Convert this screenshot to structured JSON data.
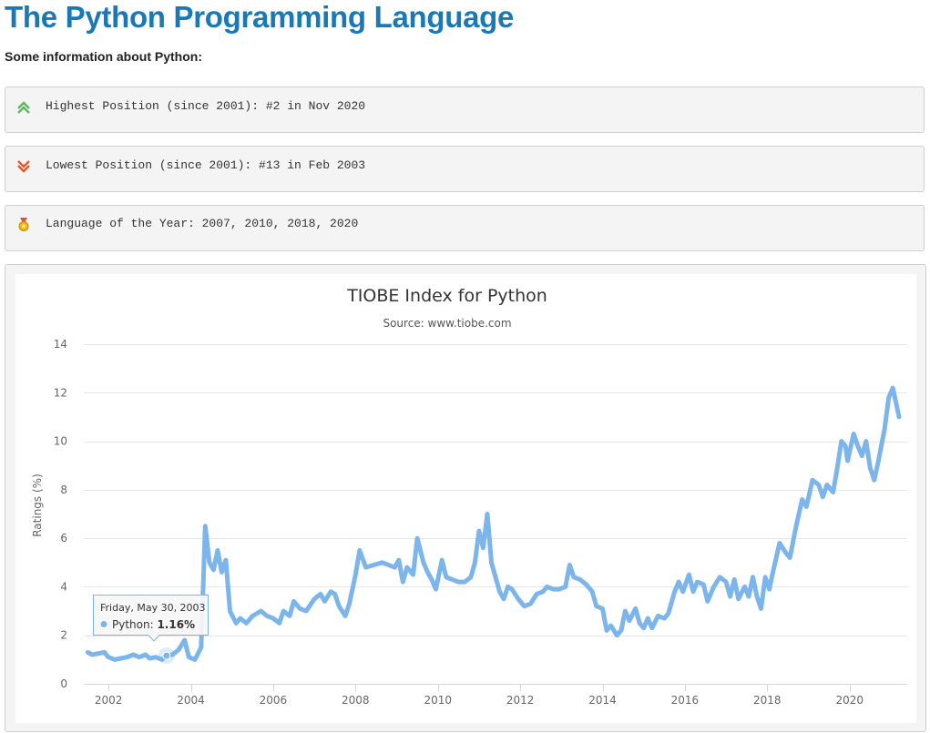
{
  "page": {
    "title": "The Python Programming Language",
    "subtitle": "Some information about Python:"
  },
  "info": {
    "highest": {
      "text": "Highest Position (since 2001): #2 in Nov 2020",
      "icon": "double-chevron-up-icon",
      "color": "#5cb85c"
    },
    "lowest": {
      "text": "Lowest Position (since 2001): #13 in Feb 2003",
      "icon": "double-chevron-down-icon",
      "color": "#e05a2b"
    },
    "year": {
      "text": "Language of the Year: 2007, 2010, 2018, 2020",
      "icon": "medal-icon",
      "color": "#f0b400"
    }
  },
  "tooltip": {
    "date": "Friday, May 30, 2003",
    "series_label": "Python: ",
    "value_label": "1.16%"
  },
  "chart_data": {
    "type": "line",
    "title": "TIOBE Index for Python",
    "subtitle": "Source: www.tiobe.com",
    "xlabel": "",
    "ylabel": "Ratings (%)",
    "ylim": [
      0,
      14
    ],
    "xlim": [
      2001.4,
      2021.4
    ],
    "yticks": [
      0,
      2,
      4,
      6,
      8,
      10,
      12,
      14
    ],
    "xticks": [
      2002,
      2004,
      2006,
      2008,
      2010,
      2012,
      2014,
      2016,
      2018,
      2020
    ],
    "grid": true,
    "line_color": "#7cb5ec",
    "highlight": {
      "x": 2003.41,
      "y": 1.16
    },
    "series": [
      {
        "name": "Python",
        "points": [
          [
            2001.5,
            1.3
          ],
          [
            2001.6,
            1.2
          ],
          [
            2001.75,
            1.25
          ],
          [
            2001.9,
            1.3
          ],
          [
            2002.0,
            1.1
          ],
          [
            2002.15,
            1.0
          ],
          [
            2002.3,
            1.05
          ],
          [
            2002.45,
            1.1
          ],
          [
            2002.6,
            1.2
          ],
          [
            2002.75,
            1.1
          ],
          [
            2002.9,
            1.2
          ],
          [
            2003.0,
            1.05
          ],
          [
            2003.15,
            1.1
          ],
          [
            2003.3,
            1.0
          ],
          [
            2003.41,
            1.16
          ],
          [
            2003.55,
            1.2
          ],
          [
            2003.7,
            1.4
          ],
          [
            2003.85,
            1.8
          ],
          [
            2003.95,
            1.1
          ],
          [
            2004.1,
            1.0
          ],
          [
            2004.25,
            1.5
          ],
          [
            2004.35,
            6.5
          ],
          [
            2004.45,
            5.0
          ],
          [
            2004.55,
            4.7
          ],
          [
            2004.65,
            5.5
          ],
          [
            2004.75,
            4.6
          ],
          [
            2004.85,
            5.1
          ],
          [
            2004.95,
            3.0
          ],
          [
            2005.1,
            2.5
          ],
          [
            2005.2,
            2.7
          ],
          [
            2005.35,
            2.5
          ],
          [
            2005.5,
            2.8
          ],
          [
            2005.7,
            3.0
          ],
          [
            2005.85,
            2.8
          ],
          [
            2006.0,
            2.7
          ],
          [
            2006.15,
            2.5
          ],
          [
            2006.25,
            3.0
          ],
          [
            2006.4,
            2.8
          ],
          [
            2006.5,
            3.4
          ],
          [
            2006.65,
            3.1
          ],
          [
            2006.8,
            3.0
          ],
          [
            2007.0,
            3.5
          ],
          [
            2007.15,
            3.7
          ],
          [
            2007.25,
            3.4
          ],
          [
            2007.4,
            3.8
          ],
          [
            2007.5,
            3.7
          ],
          [
            2007.6,
            3.2
          ],
          [
            2007.75,
            2.8
          ],
          [
            2007.85,
            3.3
          ],
          [
            2008.0,
            4.5
          ],
          [
            2008.1,
            5.5
          ],
          [
            2008.25,
            4.8
          ],
          [
            2008.45,
            4.9
          ],
          [
            2008.65,
            5.0
          ],
          [
            2008.8,
            4.9
          ],
          [
            2008.95,
            4.8
          ],
          [
            2009.05,
            5.1
          ],
          [
            2009.15,
            4.2
          ],
          [
            2009.25,
            4.8
          ],
          [
            2009.4,
            4.5
          ],
          [
            2009.5,
            6.0
          ],
          [
            2009.65,
            5.0
          ],
          [
            2009.75,
            4.6
          ],
          [
            2009.85,
            4.3
          ],
          [
            2009.95,
            3.9
          ],
          [
            2010.1,
            5.1
          ],
          [
            2010.2,
            4.4
          ],
          [
            2010.35,
            4.3
          ],
          [
            2010.5,
            4.2
          ],
          [
            2010.65,
            4.2
          ],
          [
            2010.8,
            4.4
          ],
          [
            2010.9,
            5.0
          ],
          [
            2011.0,
            6.3
          ],
          [
            2011.1,
            5.6
          ],
          [
            2011.2,
            7.0
          ],
          [
            2011.3,
            5.0
          ],
          [
            2011.4,
            4.4
          ],
          [
            2011.5,
            3.8
          ],
          [
            2011.6,
            3.5
          ],
          [
            2011.7,
            4.0
          ],
          [
            2011.8,
            3.9
          ],
          [
            2011.95,
            3.5
          ],
          [
            2012.1,
            3.2
          ],
          [
            2012.25,
            3.3
          ],
          [
            2012.4,
            3.7
          ],
          [
            2012.55,
            3.8
          ],
          [
            2012.65,
            4.0
          ],
          [
            2012.8,
            3.9
          ],
          [
            2012.95,
            3.9
          ],
          [
            2013.1,
            4.0
          ],
          [
            2013.2,
            4.9
          ],
          [
            2013.3,
            4.4
          ],
          [
            2013.45,
            4.3
          ],
          [
            2013.6,
            4.1
          ],
          [
            2013.75,
            3.8
          ],
          [
            2013.85,
            3.2
          ],
          [
            2014.0,
            3.1
          ],
          [
            2014.1,
            2.2
          ],
          [
            2014.2,
            2.4
          ],
          [
            2014.35,
            2.0
          ],
          [
            2014.45,
            2.2
          ],
          [
            2014.55,
            3.0
          ],
          [
            2014.65,
            2.6
          ],
          [
            2014.8,
            3.1
          ],
          [
            2014.9,
            2.5
          ],
          [
            2015.0,
            2.3
          ],
          [
            2015.1,
            2.7
          ],
          [
            2015.2,
            2.3
          ],
          [
            2015.35,
            2.8
          ],
          [
            2015.5,
            2.7
          ],
          [
            2015.6,
            2.9
          ],
          [
            2015.75,
            3.8
          ],
          [
            2015.85,
            4.2
          ],
          [
            2015.95,
            3.8
          ],
          [
            2016.1,
            4.5
          ],
          [
            2016.2,
            3.8
          ],
          [
            2016.3,
            4.2
          ],
          [
            2016.45,
            4.1
          ],
          [
            2016.55,
            3.4
          ],
          [
            2016.7,
            4.0
          ],
          [
            2016.85,
            4.4
          ],
          [
            2017.0,
            4.2
          ],
          [
            2017.1,
            3.6
          ],
          [
            2017.2,
            4.3
          ],
          [
            2017.3,
            3.5
          ],
          [
            2017.45,
            4.0
          ],
          [
            2017.55,
            3.6
          ],
          [
            2017.65,
            4.4
          ],
          [
            2017.75,
            3.6
          ],
          [
            2017.85,
            3.1
          ],
          [
            2017.95,
            4.4
          ],
          [
            2018.05,
            3.9
          ],
          [
            2018.15,
            4.7
          ],
          [
            2018.3,
            5.8
          ],
          [
            2018.45,
            5.4
          ],
          [
            2018.55,
            5.2
          ],
          [
            2018.7,
            6.5
          ],
          [
            2018.85,
            7.6
          ],
          [
            2018.95,
            7.3
          ],
          [
            2019.1,
            8.4
          ],
          [
            2019.25,
            8.2
          ],
          [
            2019.35,
            7.7
          ],
          [
            2019.45,
            8.2
          ],
          [
            2019.6,
            7.9
          ],
          [
            2019.7,
            8.9
          ],
          [
            2019.8,
            10.0
          ],
          [
            2019.9,
            9.8
          ],
          [
            2019.95,
            9.2
          ],
          [
            2020.1,
            10.3
          ],
          [
            2020.2,
            9.8
          ],
          [
            2020.3,
            9.4
          ],
          [
            2020.4,
            10.0
          ],
          [
            2020.5,
            8.9
          ],
          [
            2020.6,
            8.4
          ],
          [
            2020.7,
            9.2
          ],
          [
            2020.85,
            10.5
          ],
          [
            2020.95,
            11.8
          ],
          [
            2021.05,
            12.2
          ],
          [
            2021.2,
            11.0
          ]
        ]
      }
    ]
  }
}
